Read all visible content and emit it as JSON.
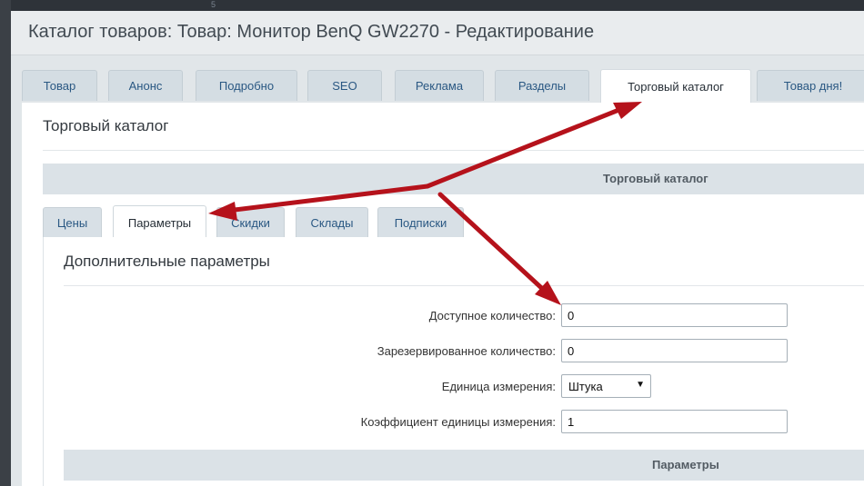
{
  "window": {
    "title": "Каталог товаров: Товар: Монитор BenQ GW2270 - Редактирование",
    "bg_tick": "5"
  },
  "tabs": [
    {
      "label": "Товар"
    },
    {
      "label": "Анонс"
    },
    {
      "label": "Подробно"
    },
    {
      "label": "SEO"
    },
    {
      "label": "Реклама"
    },
    {
      "label": "Разделы"
    },
    {
      "label": "Торговый каталог"
    },
    {
      "label": "Товар дня!"
    }
  ],
  "active_tab": "Торговый каталог",
  "panel": {
    "title": "Торговый каталог",
    "section_header": "Торговый каталог"
  },
  "subtabs": [
    {
      "label": "Цены"
    },
    {
      "label": "Параметры"
    },
    {
      "label": "Скидки"
    },
    {
      "label": "Склады"
    },
    {
      "label": "Подписки"
    }
  ],
  "active_subtab": "Параметры",
  "subpanel": {
    "title": "Дополнительные параметры",
    "fields": {
      "available_quantity": {
        "label": "Доступное количество:",
        "value": "0"
      },
      "reserved_quantity": {
        "label": "Зарезервированное количество:",
        "value": "0"
      },
      "measure_unit": {
        "label": "Единица измерения:",
        "value": "Штука"
      },
      "unit_ratio": {
        "label": "Коэффициент единицы измерения:",
        "value": "1"
      }
    },
    "params_header": "Параметры"
  },
  "colors": {
    "tab_text": "#2a5883",
    "arrow": "#b5121b"
  },
  "icons": {
    "select_arrow": "caret-down-icon"
  }
}
